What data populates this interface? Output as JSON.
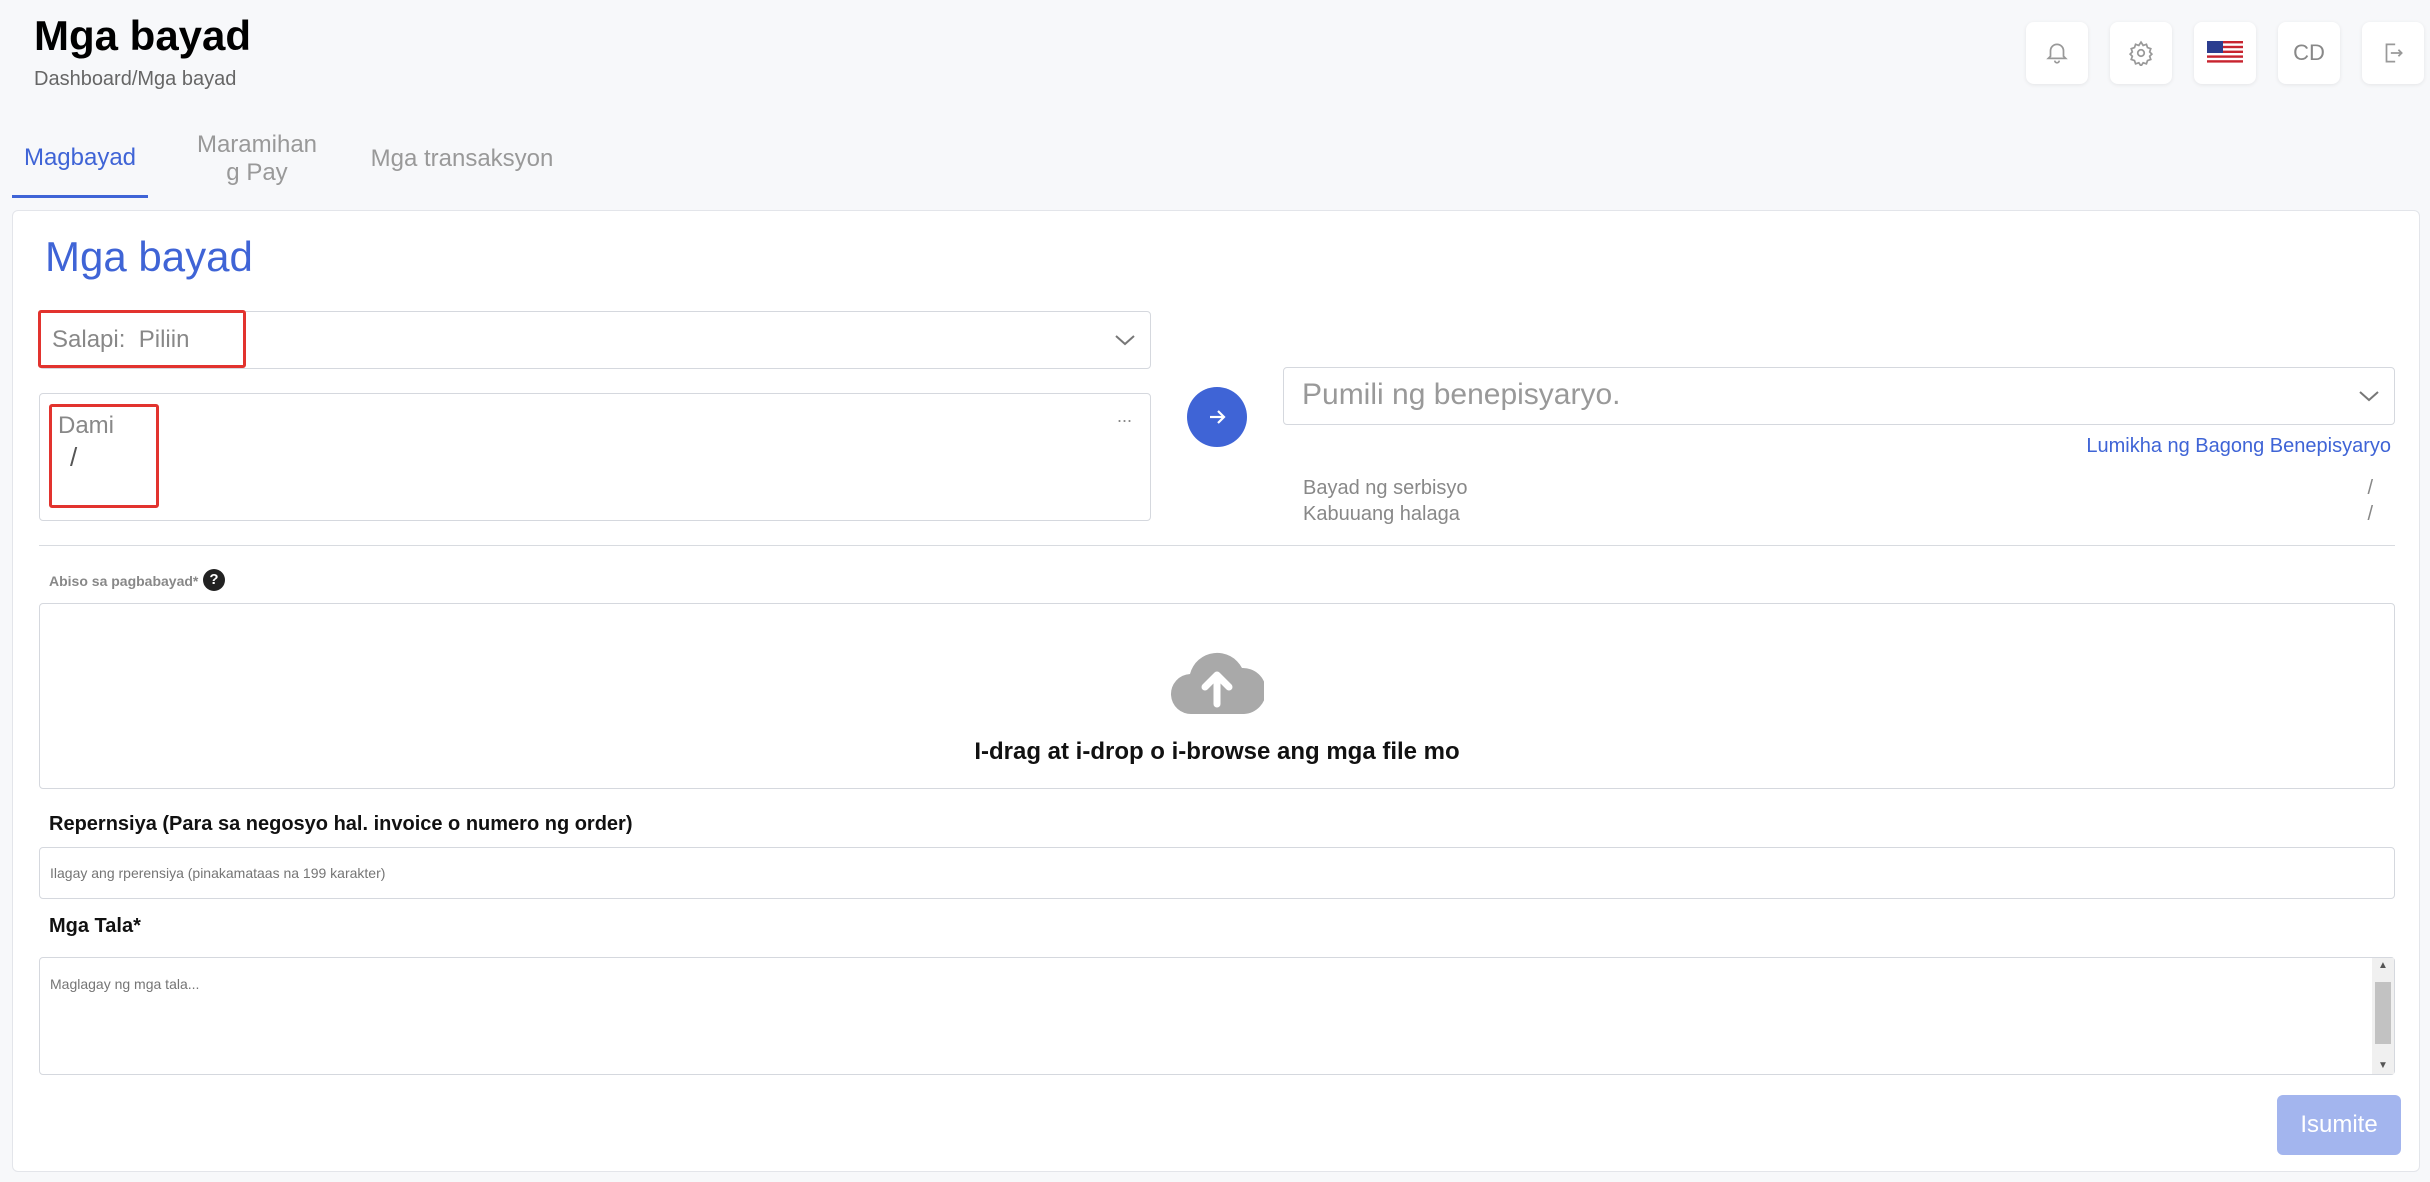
{
  "page": {
    "title": "Mga bayad",
    "breadcrumb": "Dashboard/Mga bayad"
  },
  "topbar": {
    "avatar_initials": "CD",
    "icons": [
      "bell-icon",
      "gear-icon",
      "us-flag-icon",
      "logout-icon"
    ]
  },
  "tabs": [
    {
      "label": "Magbayad",
      "active": true
    },
    {
      "label": "Maramihan g Pay",
      "active": false
    },
    {
      "label": "Mga transaksyon",
      "active": false
    }
  ],
  "form": {
    "heading": "Mga bayad",
    "currency": {
      "label": "Salapi:",
      "value": "Piliin"
    },
    "amount": {
      "label": "Dami",
      "value": "/",
      "menu": "..."
    },
    "beneficiary": {
      "placeholder": "Pumili ng benepisyaryo."
    },
    "create_beneficiary_link": "Lumikha ng Bagong Benepisyaryo",
    "service_fee": {
      "label": "Bayad ng serbisyo",
      "value": "/"
    },
    "total_amount": {
      "label": "Kabuuang halaga",
      "value": "/"
    },
    "payment_notice": {
      "label": "Abiso sa pagbabayad*",
      "help": "?"
    },
    "dropzone_text": "I-drag  at i-drop  o i-browse  ang mga file mo",
    "reference": {
      "label": "Repernsiya (Para sa negosyo hal. invoice o numero ng order)",
      "placeholder": "Ilagay ang rperensiya (pinakamataas na 199 karakter)"
    },
    "notes": {
      "label": "Mga Tala*",
      "placeholder": "Maglagay ng mga tala..."
    },
    "submit_label": "Isumite"
  },
  "colors": {
    "accent": "#3f64d6",
    "submit_disabled": "#a3b5ee",
    "highlight": "#e2332e"
  }
}
